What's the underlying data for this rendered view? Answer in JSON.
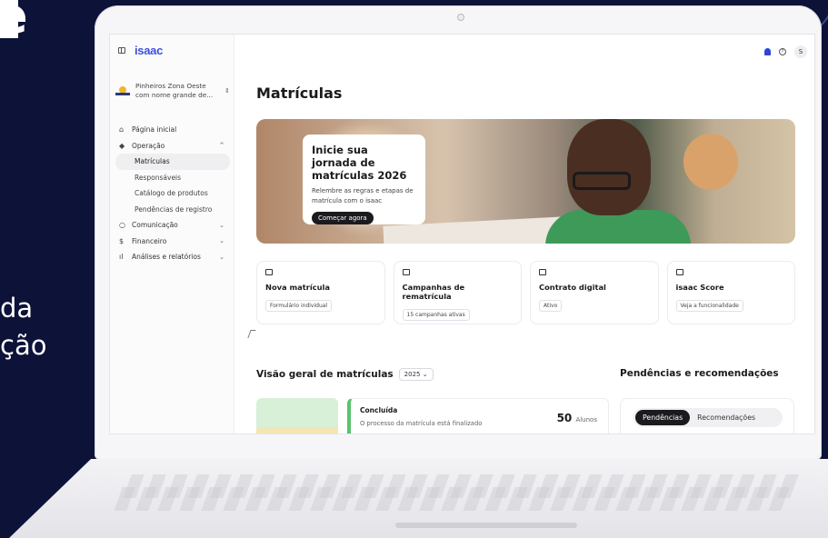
{
  "background": {
    "heading_fragment": "e",
    "line1": "da",
    "line2": "ção"
  },
  "app": {
    "logo": "isaac",
    "school": {
      "name": "Pinheiros Zona Oeste com nome grande de..."
    },
    "avatar_initial": "S"
  },
  "sidebar": {
    "items": [
      {
        "label": "Página inicial",
        "icon": "home-icon"
      },
      {
        "label": "Operação",
        "icon": "graduation-cap-icon",
        "expanded": true
      },
      {
        "label": "Matrículas",
        "sub": true,
        "active": true
      },
      {
        "label": "Responsáveis",
        "sub": true
      },
      {
        "label": "Catálogo de produtos",
        "sub": true
      },
      {
        "label": "Pendências de registro",
        "sub": true
      },
      {
        "label": "Comunicação",
        "icon": "chat-icon"
      },
      {
        "label": "Financeiro",
        "icon": "money-icon"
      },
      {
        "label": "Análises e relatórios",
        "icon": "bar-chart-icon"
      }
    ]
  },
  "main": {
    "title": "Matrículas",
    "hero": {
      "title": "Inicie sua jornada de matrículas 2026",
      "subtitle": "Relembre as regras e etapas de matrícula com o isaac",
      "button": "Começar agora"
    },
    "cards": [
      {
        "title": "Nova matrícula",
        "tag": "Formulário individual"
      },
      {
        "title": "Campanhas de rematrícula",
        "tag": "15 campanhas ativas"
      },
      {
        "title": "Contrato digital",
        "tag": "Ativo"
      },
      {
        "title": "isaac Score",
        "tag": "Veja a funcionalidade"
      }
    ],
    "overview": {
      "title": "Visão geral de matrículas",
      "year": "2025",
      "status": {
        "title": "Concluída",
        "subtitle": "O processo da matrícula está finalizado",
        "count": "50",
        "unit": "Alunos"
      }
    },
    "pending": {
      "title": "Pendências e recomendações",
      "tabs": [
        "Pendências",
        "Recomendações"
      ]
    }
  },
  "colors": {
    "accent": "#3d4fe0",
    "success": "#59c26b",
    "dark": "#1b1b1f"
  }
}
